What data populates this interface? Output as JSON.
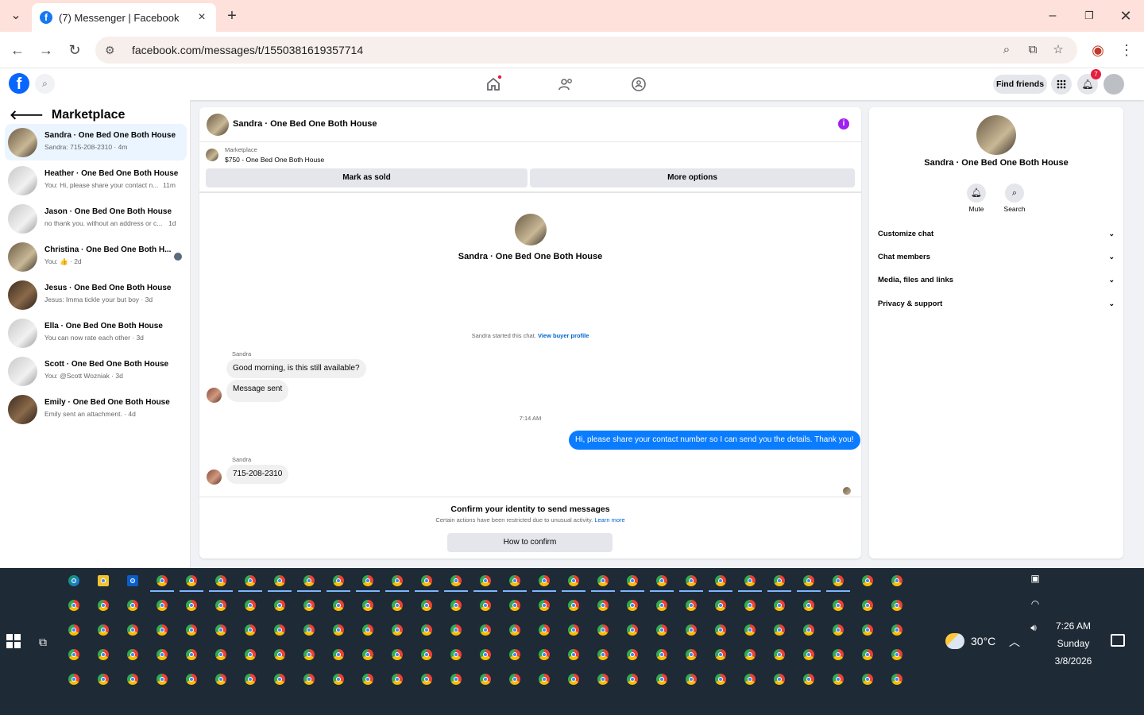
{
  "browser": {
    "tab_title": "(7) Messenger | Facebook",
    "url": "facebook.com/messages/t/1550381619357714",
    "icons": [
      "tab-dropdown-icon",
      "close-tab-icon",
      "new-tab-icon",
      "minimize-icon",
      "restore-icon",
      "close-window-icon",
      "back-icon",
      "forward-icon",
      "reload-icon",
      "site-settings-icon",
      "zoom-icon",
      "install-app-icon",
      "bookmark-star-icon",
      "profile-icon",
      "menu-icon"
    ]
  },
  "fb_header": {
    "logo": "f",
    "find_friends": "Find friends",
    "notification_count": "7"
  },
  "sidebar": {
    "title": "Marketplace",
    "conversations": [
      {
        "name": "Sandra · One Bed One Both House",
        "snippet": "Sandra: 715-208-2310 · 4m",
        "time": ""
      },
      {
        "name": "Heather · One Bed One Both House",
        "snippet": "You: Hi, please share your contact n...",
        "time": "11m"
      },
      {
        "name": "Jason · One Bed One Both House",
        "snippet": "no thank you. without an address or c...",
        "time": "1d"
      },
      {
        "name": "Christina · One Bed One Both H...",
        "snippet": "You: 👍 · 2d",
        "time": ""
      },
      {
        "name": "Jesus · One Bed One Both House",
        "snippet": "Jesus: Imma tickle your but boy · 3d",
        "time": ""
      },
      {
        "name": "Ella · One Bed One Both House",
        "snippet": "You can now rate each other · 3d",
        "time": ""
      },
      {
        "name": "Scott · One Bed One Both House",
        "snippet": "You: @Scott Wozniak · 3d",
        "time": ""
      },
      {
        "name": "Emily · One Bed One Both House",
        "snippet": "Emily sent an attachment. · 4d",
        "time": ""
      }
    ]
  },
  "chat": {
    "header_name": "Sandra · One Bed One Both House",
    "listing_source": "Marketplace",
    "listing_title": "$750 - One Bed One Both House",
    "mark_sold": "Mark as sold",
    "more_options": "More options",
    "profile_name": "Sandra · One Bed One Both House",
    "started_text": "Sandra started this chat.",
    "view_buyer_profile": "View buyer profile",
    "sender1": "Sandra",
    "msg1": "Good morning, is this still available?",
    "msg2": "Message sent",
    "timestamp": "7:14 AM",
    "msg_me": "Hi, please share your contact number so I can send you the details. Thank you!",
    "sender2": "Sandra",
    "msg3": "715-208-2310",
    "confirm_title": "Confirm your identity to send messages",
    "confirm_sub": "Certain actions have been restricted due to unusual activity.",
    "learn_more": "Learn more",
    "how_to_confirm": "How to confirm"
  },
  "info_panel": {
    "name": "Sandra · One Bed One Both House",
    "mute": "Mute",
    "search": "Search",
    "sections": [
      "Customize chat",
      "Chat members",
      "Media, files and links",
      "Privacy & support"
    ]
  },
  "taskbar": {
    "temperature": "30°C",
    "time": "7:26 AM",
    "day": "Sunday",
    "date": "3/8/2026"
  }
}
